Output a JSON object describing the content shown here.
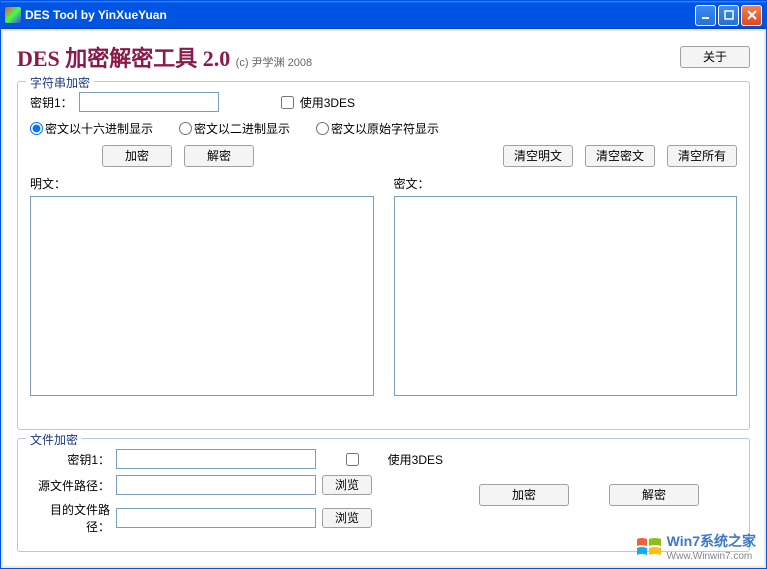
{
  "window": {
    "title": "DES Tool by YinXueYuan"
  },
  "header": {
    "app_title": "DES 加密解密工具 2.0",
    "copyright": "(c) 尹学渊 2008",
    "about_btn": "关于"
  },
  "string_group": {
    "title": "字符串加密",
    "key1_label": "密钥1：",
    "key1_value": "",
    "use3des_label": "使用3DES",
    "radio_hex": "密文以十六进制显示",
    "radio_bin": "密文以二进制显示",
    "radio_raw": "密文以原始字符显示",
    "btn_encrypt": "加密",
    "btn_decrypt": "解密",
    "btn_clear_plain": "清空明文",
    "btn_clear_cipher": "清空密文",
    "btn_clear_all": "清空所有",
    "plain_label": "明文：",
    "cipher_label": "密文：",
    "plain_value": "",
    "cipher_value": ""
  },
  "file_group": {
    "title": "文件加密",
    "key1_label": "密钥1：",
    "key1_value": "",
    "use3des_label": "使用3DES",
    "src_label": "源文件路径：",
    "src_value": "",
    "dst_label": "目的文件路径：",
    "dst_value": "",
    "browse": "浏览",
    "btn_encrypt": "加密",
    "btn_decrypt": "解密"
  },
  "watermark": {
    "line1": "Win7系统之家",
    "line2": "Www.Winwin7.com"
  }
}
